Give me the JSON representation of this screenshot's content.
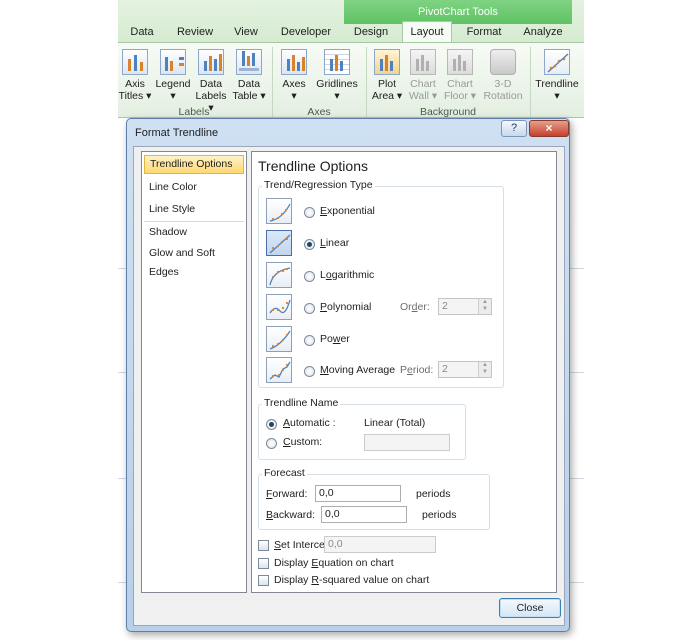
{
  "ribbon": {
    "context_title": "PivotChart Tools",
    "tabs": [
      "Data",
      "Review",
      "View",
      "Developer",
      "Design",
      "Layout",
      "Format",
      "Analyze"
    ],
    "active_tab": "Layout",
    "buttons": {
      "axis_titles": [
        "Axis",
        "Titles ▾"
      ],
      "legend": [
        "Legend",
        "▾"
      ],
      "data_labels": [
        "Data",
        "Labels ▾"
      ],
      "data_table": [
        "Data",
        "Table ▾"
      ],
      "axes": [
        "Axes",
        "▾"
      ],
      "gridlines": [
        "Gridlines",
        "▾"
      ],
      "plot_area": [
        "Plot",
        "Area ▾"
      ],
      "chart_wall": [
        "Chart",
        "Wall ▾"
      ],
      "chart_floor": [
        "Chart",
        "Floor ▾"
      ],
      "rotation": [
        "3-D",
        "Rotation"
      ],
      "trendline": [
        "Trendline",
        "▾"
      ]
    },
    "groups": {
      "labels": "Labels",
      "axes": "Axes",
      "background": "Background"
    }
  },
  "dialog": {
    "title": "Format Trendline",
    "help_label": "?",
    "close_x_label": "×",
    "close_button_label": "Close",
    "nav": [
      "Trendline Options",
      "Line Color",
      "Line Style",
      "Shadow",
      "Glow and Soft Edges"
    ],
    "selected_nav": "Trendline Options",
    "panel_title": "Trendline Options",
    "trend_type": {
      "group_label": "Trend/Regression Type",
      "options": [
        {
          "key": "E",
          "rest": "xponential",
          "pre": ""
        },
        {
          "key": "L",
          "rest": "inear",
          "pre": ""
        },
        {
          "key": "o",
          "rest": "garithmic",
          "pre": "L"
        },
        {
          "key": "P",
          "rest": "olynomial",
          "pre": ""
        },
        {
          "key": "w",
          "rest": "er",
          "pre": "Po"
        },
        {
          "key": "M",
          "rest": "oving Average",
          "pre": ""
        }
      ],
      "selected": "Linear",
      "order_label_pre": "Or",
      "order_label_key": "d",
      "order_label_rest": "er:",
      "order_value": "2",
      "period_label_pre": "P",
      "period_label_key": "e",
      "period_label_rest": "riod:",
      "period_value": "2"
    },
    "trendline_name": {
      "group_label": "Trendline Name",
      "automatic_key": "A",
      "automatic_rest": "utomatic :",
      "automatic_value": "Linear (Total)",
      "custom_key": "C",
      "custom_rest": "ustom:",
      "custom_value": "",
      "selected": "Automatic"
    },
    "forecast": {
      "group_label": "Forecast",
      "forward_key": "F",
      "forward_rest": "orward:",
      "forward_value": "0,0",
      "backward_key": "B",
      "backward_rest": "ackward:",
      "backward_value": "0,0",
      "units": "periods"
    },
    "checkboxes": {
      "set_intercept_key": "S",
      "set_intercept_rest": "et Intercept =",
      "intercept_value": "0,0",
      "display_equation_pre": "Display ",
      "display_equation_key": "E",
      "display_equation_rest": "quation on chart",
      "display_r2_pre": "Display ",
      "display_r2_key": "R",
      "display_r2_rest": "-squared value on chart"
    }
  }
}
